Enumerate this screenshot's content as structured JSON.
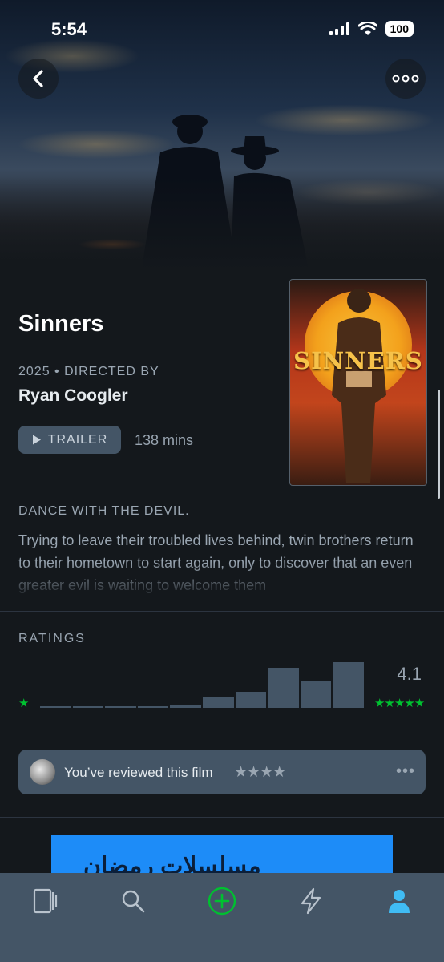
{
  "status_bar": {
    "time": "5:54",
    "battery": "100"
  },
  "film": {
    "title": "Sinners",
    "year": "2025",
    "directed_by_label": "DIRECTED BY",
    "director": "Ryan Coogler",
    "trailer_label": "TRAILER",
    "runtime": "138 mins",
    "poster_title": "SINNERS",
    "tagline": "DANCE WITH THE DEVIL.",
    "synopsis": "Trying to leave their troubled lives behind, twin brothers return to their hometown to start again, only to discover that an even greater evil is waiting to welcome them"
  },
  "ratings": {
    "label": "RATINGS",
    "average": "4.1",
    "min_star": "★",
    "max_stars": "★★★★★",
    "distribution": [
      0.02,
      0.02,
      0.02,
      0.04,
      0.05,
      0.25,
      0.35,
      0.88,
      0.6,
      1.0
    ]
  },
  "review": {
    "text": "You’ve reviewed this film",
    "stars": "★★★★",
    "more": "•••"
  },
  "ad": {
    "text": "ﻣﺴﻠﺴﻼﺕ ﺭﻣﻀﺎﻥ"
  },
  "tabs": [
    {
      "name": "films",
      "icon": "films-icon"
    },
    {
      "name": "search",
      "icon": "search-icon"
    },
    {
      "name": "add",
      "icon": "plus-circle-icon"
    },
    {
      "name": "activity",
      "icon": "lightning-icon"
    },
    {
      "name": "profile",
      "icon": "person-icon"
    }
  ],
  "colors": {
    "accent_green": "#00c030",
    "profile_blue": "#40bcf4",
    "panel": "#445566"
  }
}
